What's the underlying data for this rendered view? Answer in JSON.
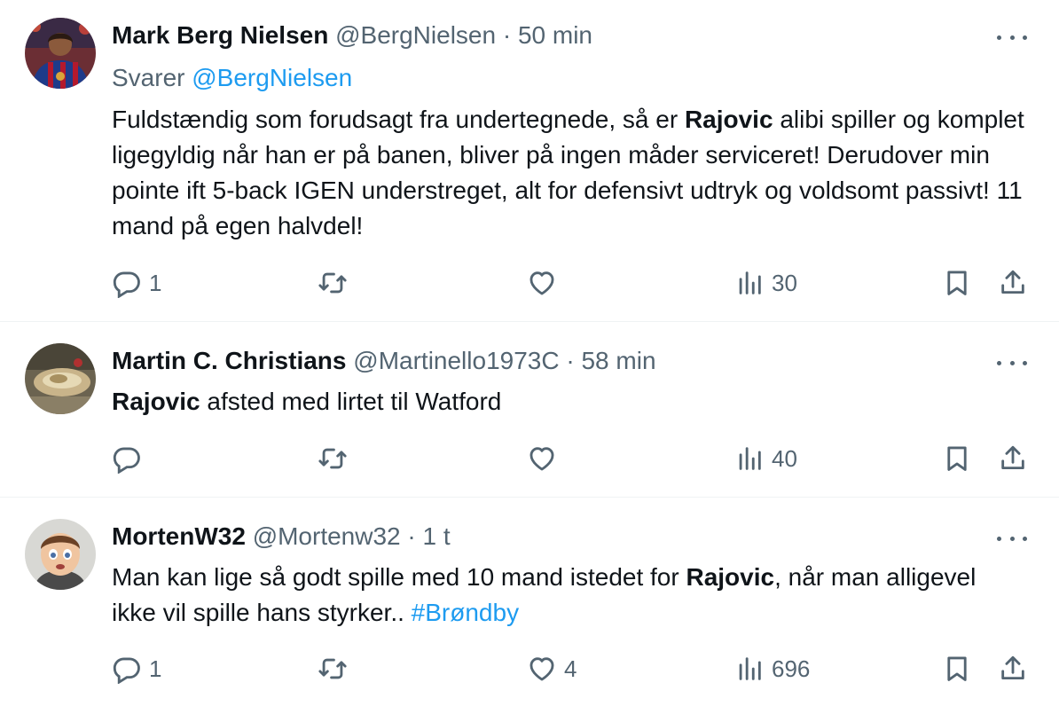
{
  "colors": {
    "text": "#0f1419",
    "muted": "#536471",
    "accent": "#1d9bf0",
    "divider": "#eff3f4"
  },
  "icons": {
    "reply": "reply-bubble-icon",
    "retweet": "retweet-arrows-icon",
    "like": "heart-icon",
    "views": "bar-chart-icon",
    "bookmark": "bookmark-icon",
    "share": "share-upload-icon",
    "more": "more-dots-icon"
  },
  "tweets": [
    {
      "name": "Mark Berg Nielsen",
      "handle": "@BergNielsen",
      "sep": "·",
      "time": "50 min",
      "reply_prefix": "Svarer",
      "reply_to": "@BergNielsen",
      "text_1": "Fuldstændig som forudsagt fra undertegnede, så er ",
      "text_bold": "Rajovic",
      "text_2": " alibi spiller og komplet ligegyldig når han er på banen, bliver på ingen måder serviceret! Derudover min pointe ift 5-back IGEN understreget, alt for defensivt udtryk og voldsomt passivt! 11 mand på egen halvdel!",
      "replies": "1",
      "retweets": "",
      "likes": "",
      "views": "30"
    },
    {
      "name": "Martin C. Christians",
      "handle": "@Martinello1973C",
      "sep": "·",
      "time": "58 min",
      "text_bold": "Rajovic",
      "text_2": " afsted med lirtet til Watford",
      "replies": "",
      "retweets": "",
      "likes": "",
      "views": "40"
    },
    {
      "name": "MortenW32",
      "handle": "@Mortenw32",
      "sep": "·",
      "time": "1 t",
      "text_1": "Man kan lige så godt spille med 10 mand istedet for ",
      "text_bold": "Rajovic",
      "text_2": ", når man alligevel ikke vil spille hans styrker.. ",
      "hashtag": "#Brøndby",
      "replies": "1",
      "retweets": "",
      "likes": "4",
      "views": "696"
    }
  ]
}
